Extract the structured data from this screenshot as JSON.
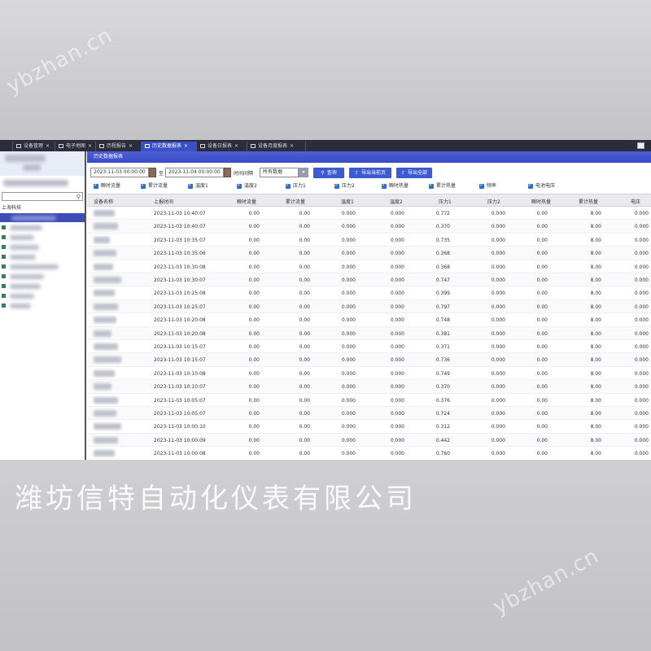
{
  "watermark_text": "ybzhan.cn",
  "company_name": "潍坊信特自动化仪表有限公司",
  "tabs": [
    {
      "label": "设备管理",
      "active": false
    },
    {
      "label": "电子地图",
      "active": false
    },
    {
      "label": "历程报告",
      "active": false
    },
    {
      "label": "历史数据报表",
      "active": true
    },
    {
      "label": "设备日报表",
      "active": false
    },
    {
      "label": "设备月度报表",
      "active": false
    }
  ],
  "main": {
    "title": "历史数据报表",
    "start_time": "2023-11-03 00:00:00",
    "end_time": "2023-11-04 00:00:00",
    "interval_label": "时间间隔",
    "interval_value": "所有数据",
    "buttons": {
      "query": "查询",
      "export_page": "导出当前页",
      "export_all": "导出全部"
    },
    "checkboxes": [
      "瞬时流量",
      "累计流量",
      "温度1",
      "温度2",
      "压力1",
      "压力2",
      "瞬时热量",
      "累计热量",
      "频率",
      "电池电压"
    ]
  },
  "table": {
    "headers": [
      "设备名称",
      "上报时间",
      "瞬时流量",
      "累计流量",
      "温度1",
      "温度2",
      "压力1",
      "压力2",
      "瞬时热量",
      "累计热量",
      "电压"
    ],
    "rows": [
      [
        "2023-11-03 10:40:07",
        "0.00",
        "0.00",
        "0.000",
        "0.000",
        "0.772",
        "0.000",
        "0.00",
        "8.00",
        "0.000"
      ],
      [
        "2023-11-03 10:40:07",
        "0.00",
        "0.00",
        "0.000",
        "0.000",
        "0.370",
        "0.000",
        "0.00",
        "8.00",
        "0.000"
      ],
      [
        "2023-11-03 10:35:07",
        "0.00",
        "0.00",
        "0.000",
        "0.000",
        "0.735",
        "0.000",
        "0.00",
        "8.00",
        "0.000"
      ],
      [
        "2023-11-03 10:35:06",
        "0.00",
        "0.00",
        "0.000",
        "0.000",
        "0.368",
        "0.000",
        "0.00",
        "8.00",
        "0.000"
      ],
      [
        "2023-11-03 10:30:08",
        "0.00",
        "0.00",
        "0.000",
        "0.000",
        "0.368",
        "0.000",
        "0.00",
        "8.00",
        "0.000"
      ],
      [
        "2023-11-03 10:30:07",
        "0.00",
        "0.00",
        "0.000",
        "0.000",
        "0.747",
        "0.000",
        "0.00",
        "8.00",
        "0.000"
      ],
      [
        "2023-11-03 10:25:08",
        "0.00",
        "0.00",
        "0.000",
        "0.000",
        "0.399",
        "0.000",
        "0.00",
        "8.00",
        "0.000"
      ],
      [
        "2023-11-03 10:25:07",
        "0.00",
        "0.00",
        "0.000",
        "0.000",
        "0.797",
        "0.000",
        "0.00",
        "8.00",
        "0.000"
      ],
      [
        "2023-11-03 10:20:08",
        "0.00",
        "0.00",
        "0.000",
        "0.000",
        "0.748",
        "0.000",
        "0.00",
        "8.00",
        "0.000"
      ],
      [
        "2023-11-03 10:20:08",
        "0.00",
        "0.00",
        "0.000",
        "0.000",
        "0.381",
        "0.000",
        "0.00",
        "8.00",
        "0.000"
      ],
      [
        "2023-11-03 10:15:07",
        "0.00",
        "0.00",
        "0.000",
        "0.000",
        "0.371",
        "0.000",
        "0.00",
        "8.00",
        "0.000"
      ],
      [
        "2023-11-03 10:15:07",
        "0.00",
        "0.00",
        "0.000",
        "0.000",
        "0.736",
        "0.000",
        "0.00",
        "8.00",
        "0.000"
      ],
      [
        "2023-11-03 10:10:08",
        "0.00",
        "0.00",
        "0.000",
        "0.000",
        "0.749",
        "0.000",
        "0.00",
        "8.00",
        "0.000"
      ],
      [
        "2023-11-03 10:10:07",
        "0.00",
        "0.00",
        "0.000",
        "0.000",
        "0.370",
        "0.000",
        "0.00",
        "8.00",
        "0.000"
      ],
      [
        "2023-11-03 10:05:07",
        "0.00",
        "0.00",
        "0.000",
        "0.000",
        "0.376",
        "0.000",
        "0.00",
        "8.00",
        "0.000"
      ],
      [
        "2023-11-03 10:05:07",
        "0.00",
        "0.00",
        "0.000",
        "0.000",
        "0.724",
        "0.000",
        "0.00",
        "8.00",
        "0.000"
      ],
      [
        "2023-11-03 10:00:10",
        "0.00",
        "0.00",
        "0.000",
        "0.000",
        "0.312",
        "0.000",
        "0.00",
        "8.00",
        "0.000"
      ],
      [
        "2023-11-03 10:00:09",
        "0.00",
        "0.00",
        "0.000",
        "0.000",
        "0.442",
        "0.000",
        "0.00",
        "8.00",
        "0.000"
      ],
      [
        "2023-11-03 10:00:08",
        "0.00",
        "0.00",
        "0.000",
        "0.000",
        "0.760",
        "0.000",
        "0.00",
        "8.00",
        "0.000"
      ]
    ]
  },
  "sidebar": {
    "root_label": "上海科技"
  },
  "colors": {
    "accent": "#3d5bd0",
    "selected_row": "#3d4db7",
    "topbar": "#2b2e3a"
  }
}
